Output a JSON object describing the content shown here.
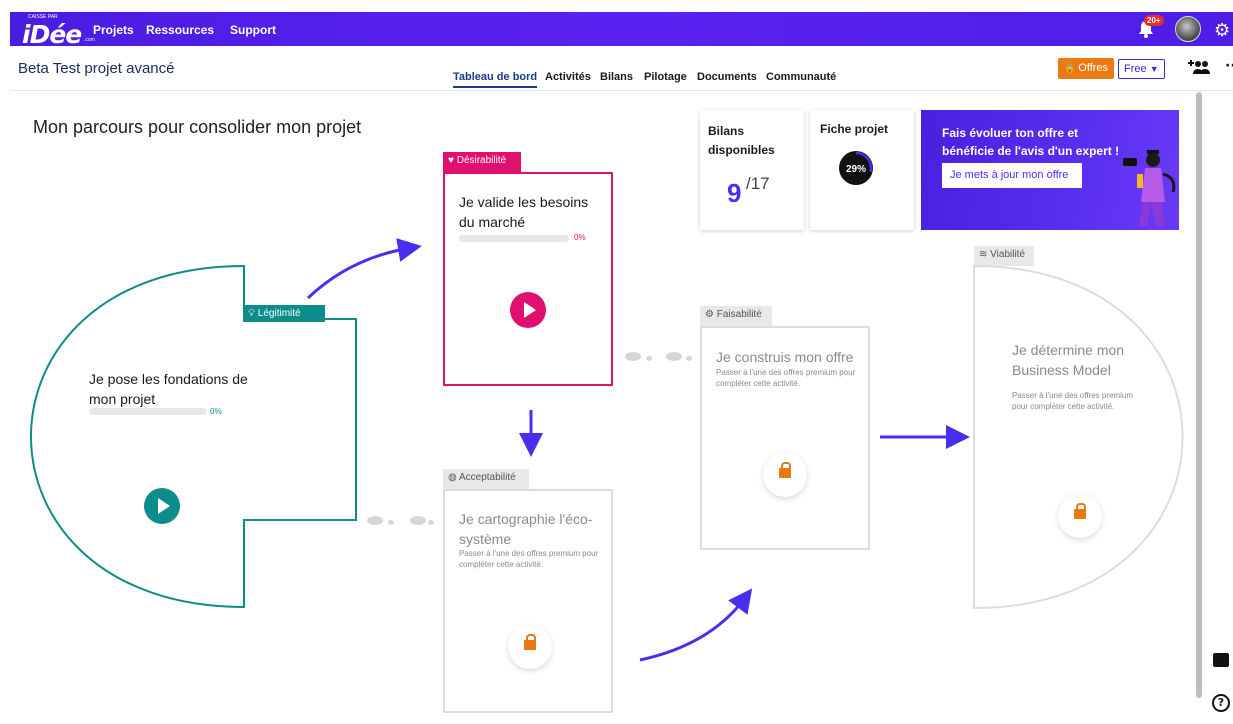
{
  "topbar": {
    "logo_text": "iDée",
    "logo_small": "CAISSE PAR",
    "logo_suffix": ".com",
    "nav": [
      "Projets",
      "Ressources",
      "Support"
    ],
    "notification_badge": "20+",
    "icons": [
      "bell-icon",
      "avatar",
      "gear-icon"
    ]
  },
  "subbar": {
    "project_title": "Beta Test projet avancé",
    "tabs": [
      "Tableau de bord",
      "Activités",
      "Bilans",
      "Pilotage",
      "Documents",
      "Communauté"
    ],
    "active_tab": "Tableau de bord",
    "offres_label": "Offres",
    "plan_label": "Free",
    "add_user_icon": "add-user-icon",
    "more_icon": "more-icon"
  },
  "main": {
    "heading": "Mon parcours pour consolider mon projet"
  },
  "stats": {
    "bilans_title": "Bilans disponibles",
    "bilans_value": "9",
    "bilans_total": "/17",
    "fiche_title": "Fiche projet",
    "fiche_percent": "29%",
    "fiche_progress": 0.29
  },
  "promo": {
    "text": "Fais évoluer ton offre et bénéficie de l'avis d'un expert !",
    "button": "Je mets à jour mon offre"
  },
  "steps": {
    "legitimite": {
      "label": "Légitimité",
      "title": "Je pose les fondations de mon projet",
      "progress": "0%",
      "color": "#0d8c8c"
    },
    "desirabilite": {
      "label": "Désirabilité",
      "title": "Je valide les besoins du marché",
      "progress": "0%",
      "color": "#e0106e"
    },
    "acceptabilite": {
      "label": "Acceptabilité",
      "title": "Je cartographie l'éco-système",
      "note": "Passer à l'une des offres premium pour compléter cette activité."
    },
    "faisabilite": {
      "label": "Faisabilité",
      "title": "Je construis mon offre",
      "note": "Passer à l'une des offres premium pour compléter cette activité."
    },
    "viabilite": {
      "label": "Viabilité",
      "title": "Je détermine mon Business Model",
      "note": "Passer à l'une des offres premium pour compléter cette activité."
    }
  },
  "colors": {
    "brand": "#4a1ce0",
    "teal": "#0d8c8c",
    "pink": "#e0106e",
    "orange": "#ec7a12",
    "arrow": "#4a2ef0",
    "grey": "#d9d9d9"
  }
}
